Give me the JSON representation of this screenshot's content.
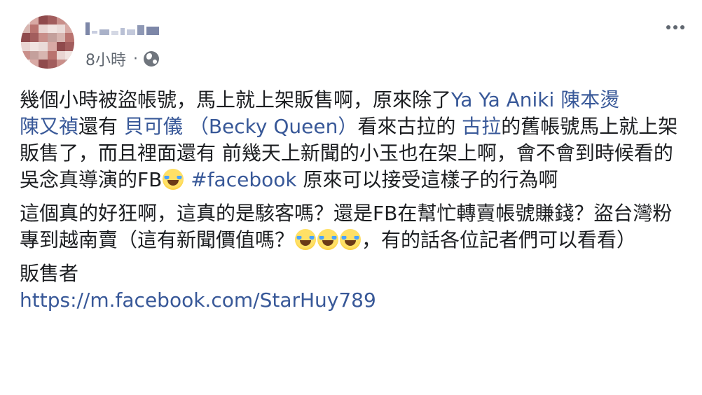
{
  "header": {
    "timestamp": "8小時",
    "separator": "·",
    "privacy_icon": "globe-icon",
    "more_icon": "ellipsis-icon"
  },
  "post": {
    "p1": {
      "t1": "幾個小時被盜帳號，馬上就上架販售啊，原來除了",
      "link1": "Ya Ya Aniki",
      "t2": " ",
      "link2": "陳本燙",
      "link3": "陳又禎",
      "t3": "還有 ",
      "link4": "貝可儀 （Becky Queen）",
      "t4": "看來古拉的 ",
      "link5": "古拉",
      "t5": "的舊帳號馬上就上架販售了，而且裡面還有 前幾天上新聞的小玉也在架上啊，會不會到時候看的吳念真導演的FB",
      "emoji1": "face-with-tears-of-joy",
      "t6": " ",
      "hashtag": "#facebook",
      "t7": " 原來可以接受這樣子的行為啊"
    },
    "p2": {
      "t1": "這個真的好狂啊，這真的是駭客嗎？還是FB在幫忙轉賣帳號賺錢？盜台灣粉專到越南賣（這有新聞價值嗎？",
      "emoji": "face-with-tears-of-joy",
      "t2": "，有的話各位記者們可以看看）"
    },
    "p3": {
      "label": "販售者",
      "url": "https://m.facebook.com/StarHuy789"
    }
  },
  "colors": {
    "link": "#385898",
    "text": "#1c1e21",
    "meta": "#606770"
  }
}
